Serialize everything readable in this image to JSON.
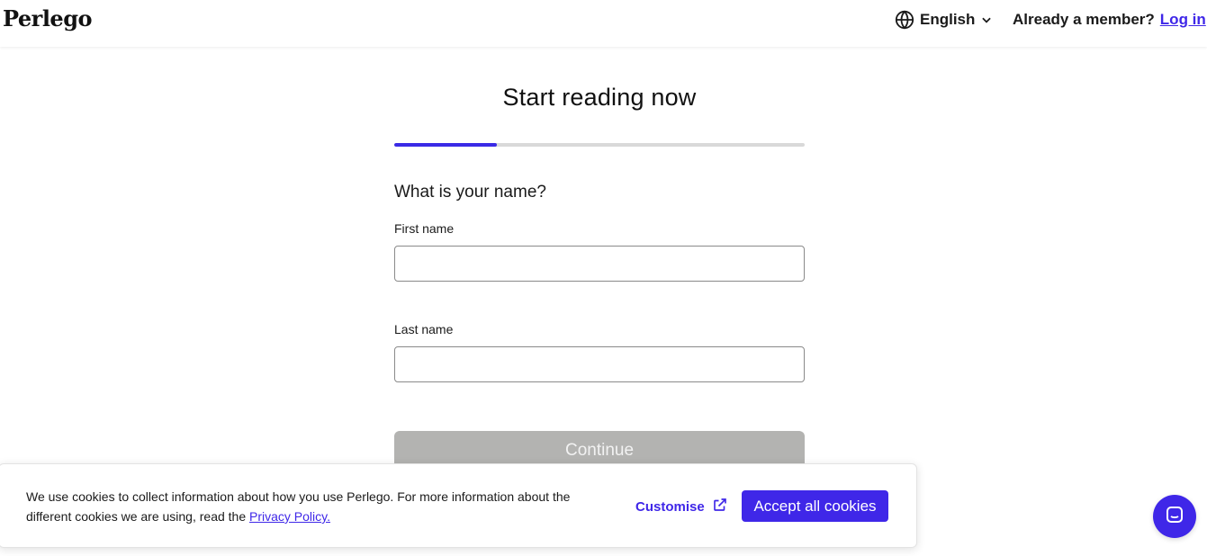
{
  "header": {
    "logo": "Perlego",
    "language": "English",
    "member_prompt": "Already a member?",
    "login_label": "Log in"
  },
  "form": {
    "title": "Start reading now",
    "progress": 0.25,
    "question": "What is your name?",
    "first_name_label": "First name",
    "first_name_value": "",
    "last_name_label": "Last name",
    "last_name_value": "",
    "continue_label": "Continue"
  },
  "cookie_banner": {
    "text": "We use cookies to collect information about how you use Perlego. For more information about the different cookies we are using, read the ",
    "privacy_link": "Privacy Policy.",
    "customise_label": "Customise",
    "accept_label": "Accept all cookies"
  },
  "colors": {
    "accent": "#3f27e8",
    "progress_track": "#d9d9d9",
    "button_disabled": "#b3b3b1"
  },
  "icons": {
    "language": "globe-icon",
    "language_toggle": "chevron-down-icon",
    "customise": "external-link-icon",
    "chat": "chat-icon"
  }
}
